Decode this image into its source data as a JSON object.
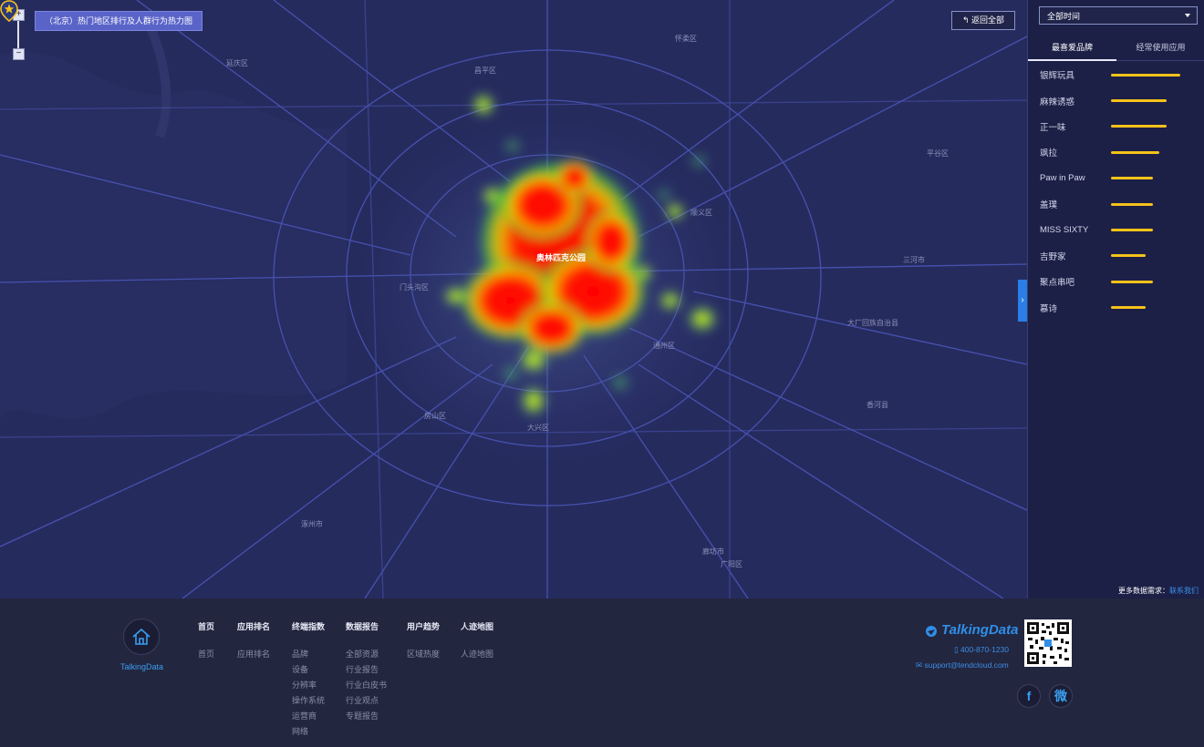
{
  "map": {
    "title": "（北京）热门地区排行及人群行为热力图",
    "back_label": "返回全部",
    "poi_label": "奥林匹克公园",
    "collapse_glyph": "›",
    "place_labels": [
      {
        "name": "怀柔区"
      },
      {
        "name": "昌平区"
      },
      {
        "name": "顺义区"
      },
      {
        "name": "平谷区"
      },
      {
        "name": "门头沟区"
      },
      {
        "name": "三河市"
      },
      {
        "name": "大厂回族自治县"
      },
      {
        "name": "房山区"
      },
      {
        "name": "大兴区"
      },
      {
        "name": "香河县"
      },
      {
        "name": "廊坊市"
      },
      {
        "name": "涿州市"
      },
      {
        "name": "广阳区"
      },
      {
        "name": "通州区"
      },
      {
        "name": "延庆区"
      }
    ]
  },
  "panel": {
    "time_select": "全部时间",
    "tabs": [
      "最喜爱品牌",
      "经常使用应用"
    ],
    "brands": [
      {
        "name": "银辉玩具",
        "value": 1.0
      },
      {
        "name": "麻辣诱惑",
        "value": 0.8
      },
      {
        "name": "正一味",
        "value": 0.8
      },
      {
        "name": "飒拉",
        "value": 0.7
      },
      {
        "name": "Paw in Paw",
        "value": 0.6
      },
      {
        "name": "盖璞",
        "value": 0.6
      },
      {
        "name": "MISS SIXTY",
        "value": 0.6
      },
      {
        "name": "吉野家",
        "value": 0.5
      },
      {
        "name": "聚点串吧",
        "value": 0.6
      },
      {
        "name": "慕诗",
        "value": 0.5
      }
    ]
  },
  "more": {
    "text": "更多数据需求：",
    "link": "联系我们"
  },
  "footer": {
    "logo_text": "TalkingData",
    "columns": [
      {
        "head": "首页",
        "items": [
          "首页"
        ]
      },
      {
        "head": "应用排名",
        "items": [
          "应用排名"
        ]
      },
      {
        "head": "终端指数",
        "items": [
          "品牌",
          "设备",
          "分辨率",
          "操作系统",
          "运营商",
          "网络"
        ]
      },
      {
        "head": "数据报告",
        "items": [
          "全部资源",
          "行业报告",
          "行业白皮书",
          "行业观点",
          "专题报告"
        ]
      },
      {
        "head": "用户趋势",
        "items": [
          "区域热度"
        ]
      },
      {
        "head": "人迹地图",
        "items": [
          "人迹地图"
        ]
      }
    ],
    "brand": "TalkingData",
    "phone": "400-870-1230",
    "email": "support@tendcloud.com",
    "social": [
      "f",
      "微"
    ]
  }
}
